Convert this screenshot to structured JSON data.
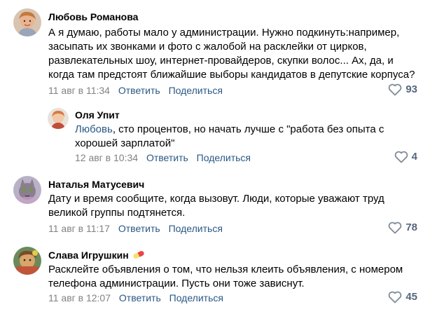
{
  "comments": [
    {
      "author": "Любовь Романова",
      "text": "А я думаю, работы мало у администрации. Нужно подкинуть:например, засыпать их звонками и фото с жалобой на расклейки от цирков, развлекательных шоу, интернет-провайдеров, скупки волос... Ах, да, и когда там предстоят ближайшие выборы кандидатов в депутские корпуса?",
      "date": "11 авг в 11:34",
      "reply_label": "Ответить",
      "share_label": "Поделиться",
      "likes": "93"
    },
    {
      "author": "Оля Упит",
      "mention": "Любовь",
      "text": ", сто процентов, но начать лучше с \"работа без опыта с хорошей зарплатой\"",
      "date": "12 авг в 10:34",
      "reply_label": "Ответить",
      "share_label": "Поделиться",
      "likes": "4"
    },
    {
      "author": "Наталья Матусевич",
      "text": "Дату и время сообщите, когда вызовут. Люди, которые уважают труд великой группы подтянется.",
      "date": "11 авг в 11:17",
      "reply_label": "Ответить",
      "share_label": "Поделиться",
      "likes": "78"
    },
    {
      "author": "Слава Игрушкин",
      "author_badge_icon": "pill-icon",
      "text": "Расклейте объявления о том, что нельзя клеить объявления, с номером телефона администрации. Пусть они тоже зависнут.",
      "date": "11 авг в 12:07",
      "reply_label": "Ответить",
      "share_label": "Поделиться",
      "likes": "45"
    }
  ],
  "colors": {
    "link": "#2a5885",
    "meta": "#828282",
    "like_count": "#55677d"
  }
}
